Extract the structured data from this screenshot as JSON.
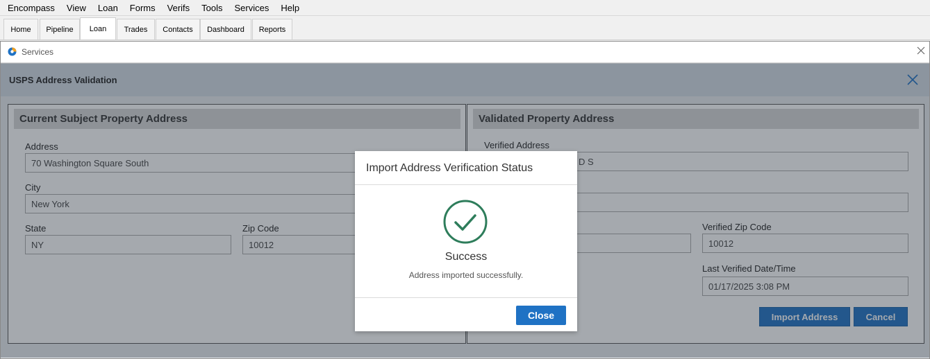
{
  "menu": [
    "Encompass",
    "View",
    "Loan",
    "Forms",
    "Verifs",
    "Tools",
    "Services",
    "Help"
  ],
  "tabs": [
    {
      "label": "Home",
      "active": false
    },
    {
      "label": "Pipeline",
      "active": false
    },
    {
      "label": "Loan",
      "active": true
    },
    {
      "label": "Trades",
      "active": false
    },
    {
      "label": "Contacts",
      "active": false
    },
    {
      "label": "Dashboard",
      "active": false
    },
    {
      "label": "Reports",
      "active": false
    }
  ],
  "window": {
    "title": "Services",
    "close_icon": "close-icon"
  },
  "panel": {
    "title": "USPS Address Validation"
  },
  "current": {
    "heading": "Current Subject Property Address",
    "address_label": "Address",
    "address_value": "70 Washington Square South",
    "city_label": "City",
    "city_value": "New York",
    "state_label": "State",
    "state_value": "NY",
    "zip_label": "Zip Code",
    "zip_value": "10012"
  },
  "validated": {
    "heading": "Validated Property Address",
    "address_label": "Verified Address",
    "address_value_visible": "D S",
    "zip_label": "Verified Zip Code",
    "zip_value": "10012",
    "date_label": "Last Verified Date/Time",
    "date_value": "01/17/2025 3:08 PM",
    "import_button": "Import Address",
    "cancel_button": "Cancel"
  },
  "modal": {
    "title": "Import Address Verification Status",
    "status": "Success",
    "message": "Address imported successfully.",
    "close_button": "Close",
    "icon": "success-check-icon"
  },
  "colors": {
    "accent": "#1f72c4",
    "success": "#2e7d5b"
  }
}
